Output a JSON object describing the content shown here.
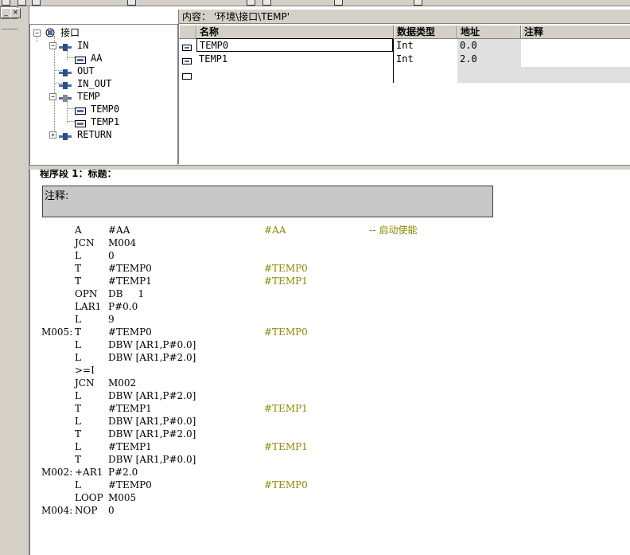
{
  "content_path": "内容： '环境\\接口\\TEMP'",
  "frame_buttons": {
    "minimize": "_",
    "close": "×"
  },
  "tree": [
    {
      "label": "接口",
      "expander": "−",
      "icon": "interface-icon",
      "level": 0
    },
    {
      "label": "IN",
      "expander": "−",
      "icon": "param-group-icon",
      "level": 1
    },
    {
      "label": "AA",
      "expander": "",
      "icon": "variable-icon",
      "level": 2
    },
    {
      "label": "OUT",
      "expander": "",
      "icon": "param-group-icon",
      "level": 1
    },
    {
      "label": "IN_OUT",
      "expander": "",
      "icon": "param-group-icon",
      "level": 1
    },
    {
      "label": "TEMP",
      "expander": "−",
      "icon": "temp-group-icon",
      "level": 1
    },
    {
      "label": "TEMP0",
      "expander": "",
      "icon": "variable-icon",
      "level": 2
    },
    {
      "label": "TEMP1",
      "expander": "",
      "icon": "variable-icon",
      "level": 2
    },
    {
      "label": "RETURN",
      "expander": "+",
      "icon": "param-group-icon",
      "level": 1
    }
  ],
  "table": {
    "headers": [
      "名称",
      "数据类型",
      "地址",
      "注释"
    ],
    "rows": [
      {
        "name": "TEMP0",
        "type": "Int",
        "address": "0.0",
        "comment": ""
      },
      {
        "name": "TEMP1",
        "type": "Int",
        "address": "2.0",
        "comment": ""
      },
      {
        "name": "",
        "type": "",
        "address": "",
        "comment": ""
      }
    ]
  },
  "editor": {
    "network_title": "程序段 1：标题：",
    "comment_label": "注释:",
    "lines": [
      {
        "label": "",
        "op": "A",
        "arg": "#AA",
        "sym": "#AA",
        "comment": "-- 启动使能"
      },
      {
        "label": "",
        "op": "JCN",
        "arg": "M004",
        "sym": "",
        "comment": ""
      },
      {
        "label": "",
        "op": "L",
        "arg": "0",
        "sym": "",
        "comment": ""
      },
      {
        "label": "",
        "op": "T",
        "arg": "#TEMP0",
        "sym": "#TEMP0",
        "comment": ""
      },
      {
        "label": "",
        "op": "T",
        "arg": "#TEMP1",
        "sym": "#TEMP1",
        "comment": ""
      },
      {
        "label": "",
        "op": "OPN",
        "arg": "DB     1",
        "sym": "",
        "comment": ""
      },
      {
        "label": "",
        "op": "LAR1",
        "arg": "P#0.0",
        "sym": "",
        "comment": ""
      },
      {
        "label": "",
        "op": "L",
        "arg": "9",
        "sym": "",
        "comment": ""
      },
      {
        "label": "M005:",
        "op": "T",
        "arg": "#TEMP0",
        "sym": "#TEMP0",
        "comment": ""
      },
      {
        "label": "",
        "op": "L",
        "arg": "DBW [AR1,P#0.0]",
        "sym": "",
        "comment": ""
      },
      {
        "label": "",
        "op": "L",
        "arg": "DBW [AR1,P#2.0]",
        "sym": "",
        "comment": ""
      },
      {
        "label": "",
        "op": ">=I",
        "arg": "",
        "sym": "",
        "comment": ""
      },
      {
        "label": "",
        "op": "JCN",
        "arg": "M002",
        "sym": "",
        "comment": ""
      },
      {
        "label": "",
        "op": "L",
        "arg": "DBW [AR1,P#2.0]",
        "sym": "",
        "comment": ""
      },
      {
        "label": "",
        "op": "T",
        "arg": "#TEMP1",
        "sym": "#TEMP1",
        "comment": ""
      },
      {
        "label": "",
        "op": "L",
        "arg": "DBW [AR1,P#0.0]",
        "sym": "",
        "comment": ""
      },
      {
        "label": "",
        "op": "T",
        "arg": "DBW [AR1,P#2.0]",
        "sym": "",
        "comment": ""
      },
      {
        "label": "",
        "op": "L",
        "arg": "#TEMP1",
        "sym": "#TEMP1",
        "comment": ""
      },
      {
        "label": "",
        "op": "T",
        "arg": "DBW [AR1,P#0.0]",
        "sym": "",
        "comment": ""
      },
      {
        "label": "M002:",
        "op": "+AR1",
        "arg": "P#2.0",
        "sym": "",
        "comment": ""
      },
      {
        "label": "",
        "op": "L",
        "arg": "#TEMP0",
        "sym": "#TEMP0",
        "comment": ""
      },
      {
        "label": "",
        "op": "LOOP",
        "arg": "M005",
        "sym": "",
        "comment": ""
      },
      {
        "label": "M004:",
        "op": "NOP",
        "arg": "0",
        "sym": "",
        "comment": ""
      }
    ]
  },
  "colors": {
    "symbol": "#8a8a00",
    "panel": "#d4d0c8",
    "comment_box": "#c8c8c8",
    "address_bg": "#e0e0e0"
  }
}
